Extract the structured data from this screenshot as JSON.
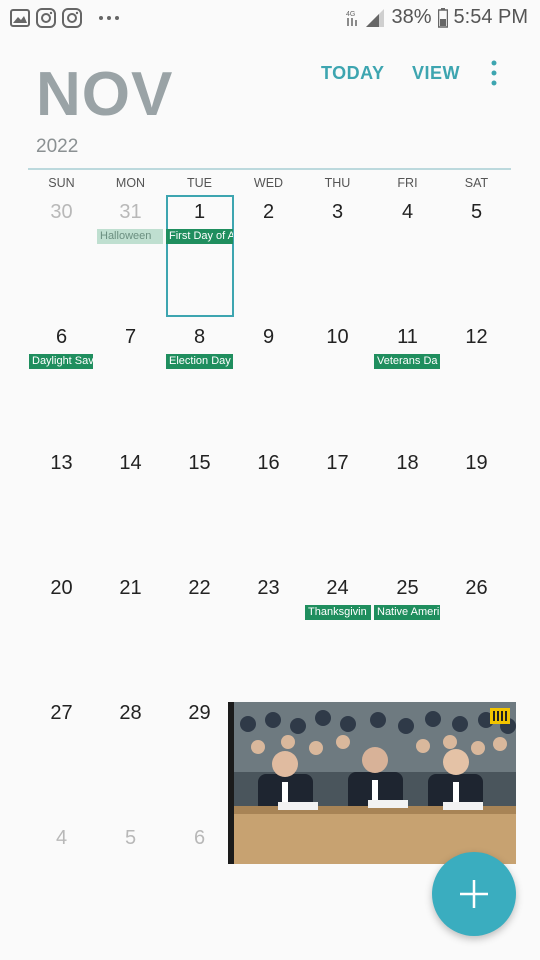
{
  "status_bar": {
    "battery": "38%",
    "time": "5:54 PM",
    "left_icons": [
      "image-icon",
      "instagram-icon",
      "instagram-icon",
      "more-dots-icon"
    ],
    "right_icons": [
      "wifi-calling-icon",
      "signal-icon",
      "battery-icon"
    ]
  },
  "header": {
    "month": "NOV",
    "year": "2022",
    "today_label": "TODAY",
    "view_label": "VIEW",
    "more_icon": "more-vert-icon"
  },
  "weekdays": [
    "SUN",
    "MON",
    "TUE",
    "WED",
    "THU",
    "FRI",
    "SAT"
  ],
  "weeks": [
    [
      "30",
      "31",
      "1",
      "2",
      "3",
      "4",
      "5"
    ],
    [
      "6",
      "7",
      "8",
      "9",
      "10",
      "11",
      "12"
    ],
    [
      "13",
      "14",
      "15",
      "16",
      "17",
      "18",
      "19"
    ],
    [
      "20",
      "21",
      "22",
      "23",
      "24",
      "25",
      "26"
    ],
    [
      "27",
      "28",
      "29",
      "",
      "",
      "",
      ""
    ],
    [
      "4",
      "5",
      "6",
      "",
      "",
      "",
      ""
    ]
  ],
  "events": {
    "halloween": "Halloween",
    "first_day": "First Day of A",
    "daylight": "Daylight Savi",
    "election": "Election Day",
    "veterans": "Veterans Da",
    "thanksgiving": "Thanksgivin",
    "native": "Native Ameri"
  },
  "selected_day": "1",
  "colors": {
    "accent": "#3da5b0",
    "event_green": "#1f8e5e",
    "fab": "#3aadbf"
  },
  "pip_video": {
    "description_icon": "video-thumbnail",
    "badge": "|||"
  },
  "fab_icon": "plus-icon"
}
